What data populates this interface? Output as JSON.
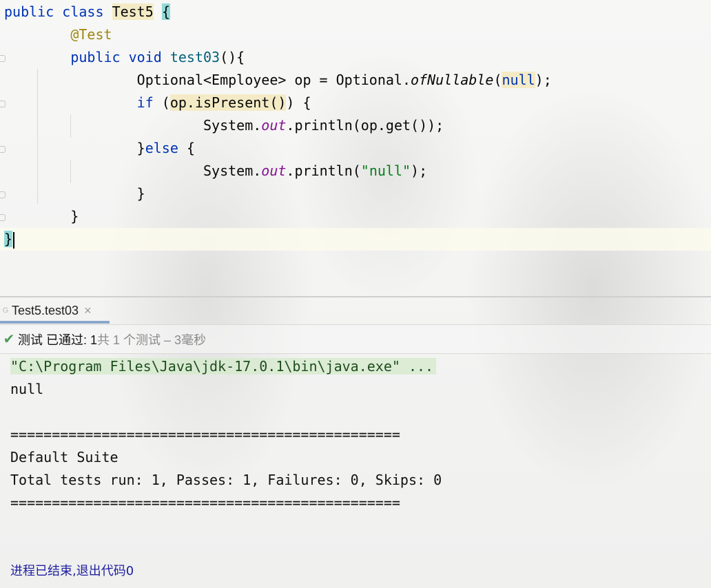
{
  "editor": {
    "class_decl": {
      "kw1": "public",
      "kw2": "class",
      "name": "Test5",
      "brace": "{"
    },
    "annotation": "@Test",
    "method_decl": {
      "kw1": "public",
      "kw2": "void",
      "name": "test03",
      "rest": "(){"
    },
    "line_optional": {
      "p1": "Optional<Employee> op = Optional.",
      "call": "ofNullable",
      "paren_open": "(",
      "arg": "null",
      "p2": ");"
    },
    "line_if": {
      "kw": "if",
      "space": " ",
      "paren": "(",
      "cond": "op.isPresent()",
      "rest": ") {"
    },
    "line_print1": {
      "p1": "System.",
      "field": "out",
      "p2": ".println(op.get());"
    },
    "line_else": {
      "p1": "}",
      "kw": "else",
      "p2": " {"
    },
    "line_print2": {
      "p1": "System.",
      "field": "out",
      "p2": ".println(",
      "str": "\"null\"",
      "p3": ");"
    },
    "close_if": "}",
    "close_method": "}",
    "close_class": "}"
  },
  "run_panel": {
    "tab_label": "Test5.test03",
    "tab_close": "×",
    "status_main": "测试 已通过: 1",
    "status_detail": "共 1 个测试 – 3毫秒",
    "console": {
      "cmd": "\"C:\\Program Files\\Java\\jdk-17.0.1\\bin\\java.exe\" ...",
      "output": "null",
      "sep1": "===============================================",
      "suite": "Default Suite",
      "summary": "Total tests run: 1, Passes: 1, Failures: 0, Skips: 0",
      "sep2": "===============================================",
      "exit": "进程已结束,退出代码0"
    }
  },
  "colors": {
    "keyword": "#0033b3",
    "annotation": "#9e880d",
    "method": "#00627a",
    "static_field": "#871094",
    "string": "#067d17",
    "pass_check": "#4f9a5a"
  }
}
